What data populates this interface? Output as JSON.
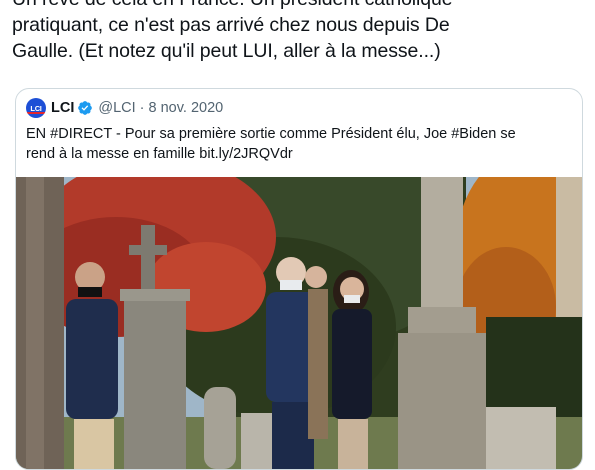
{
  "tweet": {
    "lines": [
      "Un rêve de cela en France. Un président catholique",
      "pratiquant, ce n'est pas arrivé chez nous depuis De",
      "Gaulle. (Et notez qu'il peut LUI, aller à la messe...)"
    ]
  },
  "quote": {
    "avatar_text": "LCI",
    "author_name": "LCI",
    "verified_icon": "verified-badge-icon",
    "handle": "@LCI",
    "separator": "·",
    "date": "8 nov. 2020",
    "text_lines": [
      "EN #DIRECT - Pour sa première sortie comme Président élu, Joe #Biden se",
      "rend à la messe en famille bit.ly/2JRQVdr"
    ]
  },
  "colors": {
    "text": "#0f1419",
    "secondary": "#536471",
    "verified": "#1d9bf0",
    "border": "#cfd9de",
    "brand": "#1d4fd6"
  }
}
